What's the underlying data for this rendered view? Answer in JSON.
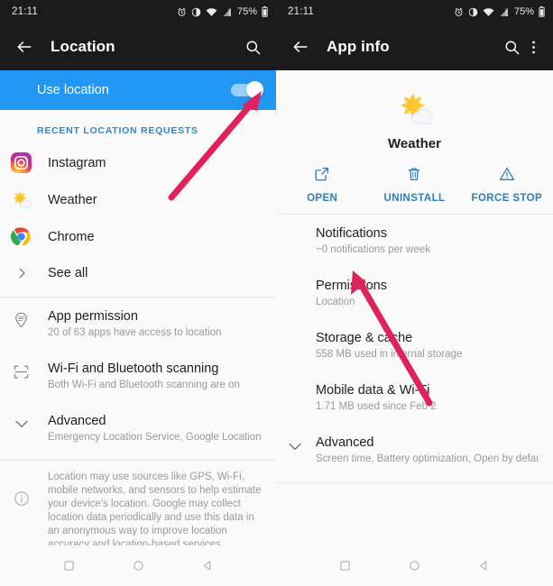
{
  "colors": {
    "accent_blue": "#2196f3",
    "link_blue": "#2d7fbe",
    "section_header_blue": "#2e86d4",
    "arrow_crimson": "#e0215a",
    "statusbar_bg": "#1b1b1b",
    "panel_bg": "#fafafa"
  },
  "left": {
    "statusbar": {
      "time": "21:11",
      "battery_percent": "75%",
      "icons": [
        "alarm-icon",
        "do-not-disturb-icon",
        "wifi-icon",
        "signal-icon",
        "battery-icon"
      ]
    },
    "toolbar": {
      "back": "back-arrow-icon",
      "title": "Location",
      "search": "search-icon"
    },
    "use_location": {
      "label": "Use location",
      "toggle_state": "on"
    },
    "section_header": "RECENT LOCATION REQUESTS",
    "apps": [
      {
        "name": "Instagram",
        "icon": "instagram-icon"
      },
      {
        "name": "Weather",
        "icon": "weather-icon"
      },
      {
        "name": "Chrome",
        "icon": "chrome-icon"
      }
    ],
    "see_all": {
      "label": "See all",
      "icon": "chevron-right-icon"
    },
    "settings": [
      {
        "title": "App permission",
        "subtitle": "20 of 63 apps have access to location",
        "icon": "location-permission-icon"
      },
      {
        "title": "Wi-Fi and Bluetooth scanning",
        "subtitle": "Both Wi-Fi and Bluetooth scanning are on",
        "icon": "scan-frame-icon"
      },
      {
        "title": "Advanced",
        "subtitle": "Emergency Location Service, Google Location Accuracy, Goo··",
        "icon": "chevron-down-icon"
      }
    ],
    "footnote": {
      "icon": "info-icon",
      "text": "Location may use sources like GPS, Wi-Fi, mobile networks, and sensors to help estimate your device's location. Google may collect location data periodically and use this data in an anonymous way to improve location accuracy and location-based services."
    },
    "navbar": [
      "square-recents-icon",
      "circle-home-icon",
      "triangle-back-icon"
    ]
  },
  "right": {
    "statusbar": {
      "time": "21:11",
      "battery_percent": "75%",
      "icons": [
        "alarm-icon",
        "do-not-disturb-icon",
        "wifi-icon",
        "signal-icon",
        "battery-icon"
      ]
    },
    "toolbar": {
      "back": "back-arrow-icon",
      "title": "App info",
      "search": "search-icon",
      "overflow": "overflow-menu-icon"
    },
    "app": {
      "icon": "weather-icon",
      "name": "Weather"
    },
    "actions": [
      {
        "label": "OPEN",
        "icon": "open-external-icon"
      },
      {
        "label": "UNINSTALL",
        "icon": "trash-icon"
      },
      {
        "label": "FORCE STOP",
        "icon": "warning-triangle-icon"
      }
    ],
    "rows": [
      {
        "title": "Notifications",
        "subtitle": "~0 notifications per week"
      },
      {
        "title": "Permissions",
        "subtitle": "Location"
      },
      {
        "title": "Storage & cache",
        "subtitle": "558 MB used in internal storage"
      },
      {
        "title": "Mobile data & Wi-Fi",
        "subtitle": "1.71 MB used since Feb 2"
      },
      {
        "title": "Advanced",
        "subtitle": "Screen time, Battery optimization, Open by default",
        "icon": "chevron-down-icon"
      }
    ],
    "navbar": [
      "square-recents-icon",
      "circle-home-icon",
      "triangle-back-icon"
    ]
  },
  "annotations": [
    {
      "name": "arrow-to-use-location-toggle",
      "color": "#e0215a"
    },
    {
      "name": "arrow-to-permissions-location",
      "color": "#e0215a"
    }
  ]
}
